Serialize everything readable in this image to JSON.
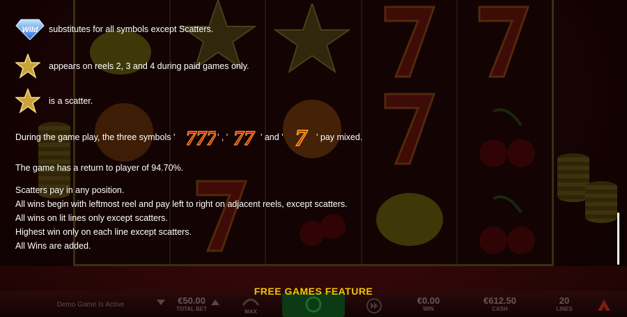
{
  "info": {
    "wild_label": "Wild",
    "line1": "substitutes for all symbols except Scatters.",
    "line2": "appears on reels 2, 3 and 4 during paid games only.",
    "line3": "is a scatter.",
    "mixed_prefix": "During the game play, the three symbols '",
    "mixed_sep1": "' , '",
    "mixed_sep2": "' and '",
    "mixed_suffix": "' pay mixed.",
    "rtp": "The game has a return to player of 94.70%.",
    "rules": [
      "Scatters pay in any position.",
      "All wins begin with leftmost reel and pay left to right on adjacent reels, except scatters.",
      "All wins on lit lines only except scatters.",
      "Highest win only on each line except scatters.",
      "All Wins are added."
    ]
  },
  "feature_title": "FREE GAMES FEATURE",
  "bottom_bar": {
    "demo_status": "Demo Game Is Active",
    "total_bet_value": "€50.00",
    "total_bet_label": "TOTAL BET",
    "max_label": "MAX",
    "win_value": "€0.00",
    "win_label": "WIN",
    "cash_value": "€612.50",
    "cash_label": "CASH",
    "lines_value": "20",
    "lines_label": "LINES"
  },
  "colors": {
    "accent_gold": "#f5c400",
    "text": "#ffffff",
    "seven_red": "#c0170f"
  },
  "icons": [
    "wild-diamond-icon",
    "gold-star-icon",
    "scatter-star-icon",
    "seven-icon",
    "play-icon",
    "fast-forward-icon",
    "brand-logo-icon"
  ]
}
